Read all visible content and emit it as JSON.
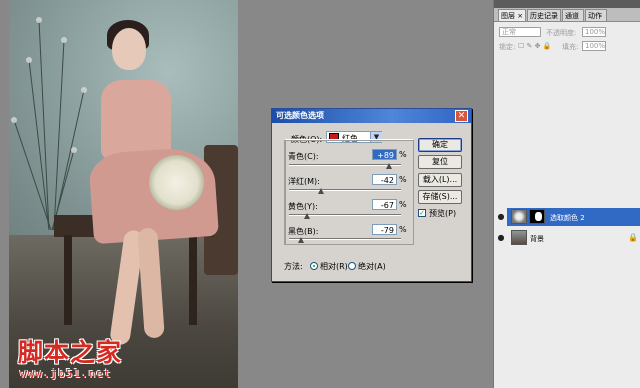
{
  "watermark": {
    "title": "脚本之家",
    "url": "www.jb51.net"
  },
  "dialog": {
    "title": "可选颜色选项",
    "close_glyph": "✕",
    "colors_label": "颜色(O):",
    "colors_value": "红色",
    "cyan_label": "青色(C):",
    "cyan_value": "+89",
    "magenta_label": "洋红(M):",
    "magenta_value": "-42",
    "yellow_label": "黄色(Y):",
    "yellow_value": "-67",
    "black_label": "黑色(B):",
    "black_value": "-79",
    "percent": "%",
    "ok_label": "确定",
    "reset_label": "复位",
    "load_label": "载入(L)...",
    "save_label": "存储(S)...",
    "preview_label": "预览(P)",
    "method_label": "方法:",
    "relative_label": "相对(R)",
    "absolute_label": "绝对(A)",
    "slider_levels": {
      "cyan": 0.89,
      "magenta": 0.29,
      "yellow": 0.165,
      "black": 0.105
    }
  },
  "panel": {
    "tabs": [
      "图层 ×",
      "历史记录",
      "通道",
      "动作"
    ],
    "blend_mode": "正常",
    "opacity_label": "不透明度:",
    "opacity_value": "100%",
    "lock_label": "锁定:",
    "fill_label": "填充:",
    "fill_value": "100%",
    "layers": [
      {
        "name": "选取颜色 2",
        "selected": true
      },
      {
        "name": "背景",
        "selected": false
      }
    ]
  },
  "colors": {
    "accent": "#316ac5",
    "watermark": "#d42a22",
    "swatch_red": "#c01c1c"
  }
}
